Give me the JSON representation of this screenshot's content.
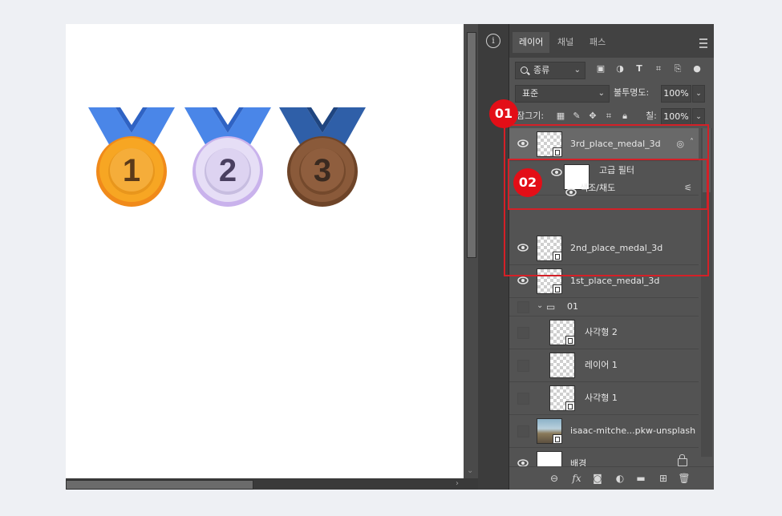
{
  "canvas": {
    "medals": [
      {
        "number": "1",
        "ribbon": "#4a86e8",
        "face": "#f7a623",
        "digit": "#5a3a1a"
      },
      {
        "number": "2",
        "ribbon": "#4a86e8",
        "face": "#d9cdf0",
        "digit": "#4a3f60"
      },
      {
        "number": "3",
        "ribbon": "#2f5fa8",
        "face": "#8a5a3a",
        "digit": "#3a2a20"
      }
    ]
  },
  "panel": {
    "tabs": [
      {
        "label": "레이어"
      },
      {
        "label": "채널"
      },
      {
        "label": "패스"
      }
    ],
    "filter_kind": "종류",
    "blend_mode": "표준",
    "opacity_label": "불투명도:",
    "opacity_value": "100%",
    "lock_label": "잠그기:",
    "fill_label": "칠:",
    "fill_value": "100%"
  },
  "layers": [
    {
      "name": "3rd_place_medal_3d",
      "type": "smart",
      "visible": true,
      "selected": true
    },
    {
      "name": "고급 필터",
      "type": "filter-mask"
    },
    {
      "name": "색조/채도",
      "type": "filter"
    },
    {
      "name": "2nd_place_medal_3d",
      "type": "smart",
      "visible": true
    },
    {
      "name": "1st_place_medal_3d",
      "type": "smart",
      "visible": true
    },
    {
      "name": "01",
      "type": "group",
      "visible": false
    },
    {
      "name": "사각형 2",
      "type": "shape",
      "visible": false
    },
    {
      "name": "레이어 1",
      "type": "pixel",
      "visible": false
    },
    {
      "name": "사각형 1",
      "type": "shape",
      "visible": false
    },
    {
      "name": "isaac-mitche...pkw-unsplash",
      "type": "smart-photo",
      "visible": false
    },
    {
      "name": "배경",
      "type": "background",
      "visible": true,
      "locked": true
    }
  ],
  "callouts": [
    {
      "label": "01"
    },
    {
      "label": "02"
    }
  ],
  "colors": {
    "callout": "#e30e17",
    "highlight": "#d42027"
  }
}
